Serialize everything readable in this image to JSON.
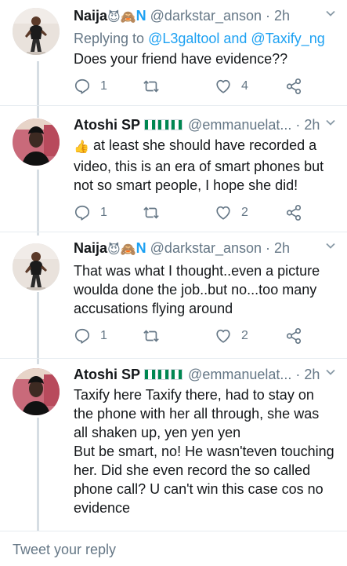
{
  "tweets": [
    {
      "name": "Naija",
      "name_icons": [
        "smiling-imp-emoji",
        "see-no-evil-monkey-emoji"
      ],
      "name_suffix": "N",
      "handle": "@darkstar_anson",
      "time": "· 2h",
      "replying_prefix": "Replying to ",
      "replying_users": "@L3galtool and @Taxify_ng",
      "text": "Does your friend have evidence??",
      "reply_count": "1",
      "retweet_count": "",
      "like_count": "4"
    },
    {
      "name": "Atoshi SP",
      "name_icons": [
        "nigeria-flag-emoji",
        "nigeria-flag-emoji",
        "nigeria-flag-emoji"
      ],
      "handle": "@emmanuelat...",
      "time": "· 2h",
      "text_emoji": "👍",
      "text": "at least she should have recorded a video, this is an era of smart phones but not so smart people, I hope she did!",
      "reply_count": "1",
      "retweet_count": "",
      "like_count": "2"
    },
    {
      "name": "Naija",
      "name_icons": [
        "smiling-imp-emoji",
        "see-no-evil-monkey-emoji"
      ],
      "name_suffix": "N",
      "handle": "@darkstar_anson",
      "time": "· 2h",
      "text": "That was what I thought..even a picture woulda done the job..but no...too many accusations flying around",
      "reply_count": "1",
      "retweet_count": "",
      "like_count": "2"
    },
    {
      "name": "Atoshi SP",
      "name_icons": [
        "nigeria-flag-emoji",
        "nigeria-flag-emoji",
        "nigeria-flag-emoji"
      ],
      "handle": "@emmanuelat...",
      "time": "· 2h",
      "text": "Taxify here Taxify there, had to stay on the phone with her all through, she was all shaken up, yen yen yen\nBut be smart, no! He wasn'teven touching her. Did she even record the so called phone call? U can't win this case cos no evidence"
    }
  ],
  "reply_placeholder": "Tweet your reply",
  "colors": {
    "accent": "#1da1f2",
    "muted": "#657786",
    "nigeria_green": "#008751"
  }
}
